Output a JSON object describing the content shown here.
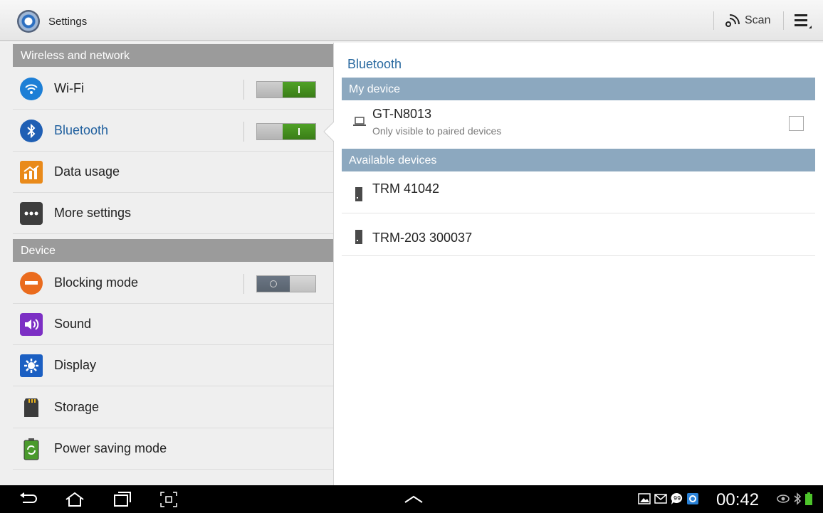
{
  "action_bar": {
    "title": "Settings",
    "scan_label": "Scan"
  },
  "left_panel": {
    "sections": [
      {
        "header": "Wireless and network",
        "items": [
          {
            "label": "Wi-Fi",
            "icon": "wifi-icon",
            "toggle": "on"
          },
          {
            "label": "Bluetooth",
            "icon": "bluetooth-icon",
            "toggle": "on",
            "selected": true
          },
          {
            "label": "Data usage",
            "icon": "data-usage-icon"
          },
          {
            "label": "More settings",
            "icon": "more-settings-icon"
          }
        ]
      },
      {
        "header": "Device",
        "items": [
          {
            "label": "Blocking mode",
            "icon": "blocking-mode-icon",
            "toggle": "off"
          },
          {
            "label": "Sound",
            "icon": "sound-icon"
          },
          {
            "label": "Display",
            "icon": "display-icon"
          },
          {
            "label": "Storage",
            "icon": "storage-icon"
          },
          {
            "label": "Power saving mode",
            "icon": "power-saving-icon"
          }
        ]
      }
    ]
  },
  "right_panel": {
    "title": "Bluetooth",
    "my_device_header": "My device",
    "my_device": {
      "name": "GT-N8013",
      "subtitle": "Only visible to paired devices",
      "checked": false
    },
    "available_header": "Available devices",
    "available": [
      {
        "name": "TRM 41042"
      },
      {
        "name": "TRM-203 300037"
      }
    ]
  },
  "status_bar": {
    "time": "00:42"
  },
  "colors": {
    "accent_blue": "#2a6aa0",
    "section_gray": "#9b9b9b",
    "right_header": "#8ca8bf",
    "toggle_green": "#4fa126"
  }
}
